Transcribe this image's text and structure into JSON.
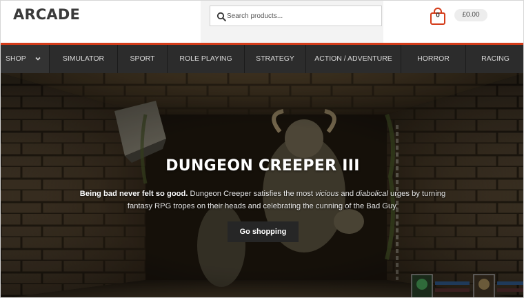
{
  "header": {
    "logo": "ARCADE",
    "search_placeholder": "Search products...",
    "cart_count": "0",
    "cart_total": "£0.00"
  },
  "nav": {
    "items": [
      {
        "label": "SHOP",
        "has_dropdown": true
      },
      {
        "label": "SIMULATOR"
      },
      {
        "label": "SPORT"
      },
      {
        "label": "ROLE PLAYING"
      },
      {
        "label": "STRATEGY"
      },
      {
        "label": "ACTION / ADVENTURE"
      },
      {
        "label": "HORROR"
      },
      {
        "label": "RACING"
      }
    ]
  },
  "hero": {
    "title": "DUNGEON CREEPER III",
    "lead_bold": "Being bad never felt so good.",
    "text_1": " Dungeon Creeper satisfies the most ",
    "em_1": "vicious",
    "text_2": " and ",
    "em_2": "diabolical",
    "text_3": " urges by turning fantasy RPG tropes on their heads and celebrating the cunning of the Bad Guy.",
    "button_label": "Go shopping"
  },
  "colors": {
    "accent": "#d43c1a",
    "nav_bg": "#2c2c2c",
    "logo": "#3a3a3a"
  },
  "icons": {
    "search": "search-icon",
    "cart": "shopping-bag-icon",
    "dropdown": "chevron-down-icon"
  }
}
